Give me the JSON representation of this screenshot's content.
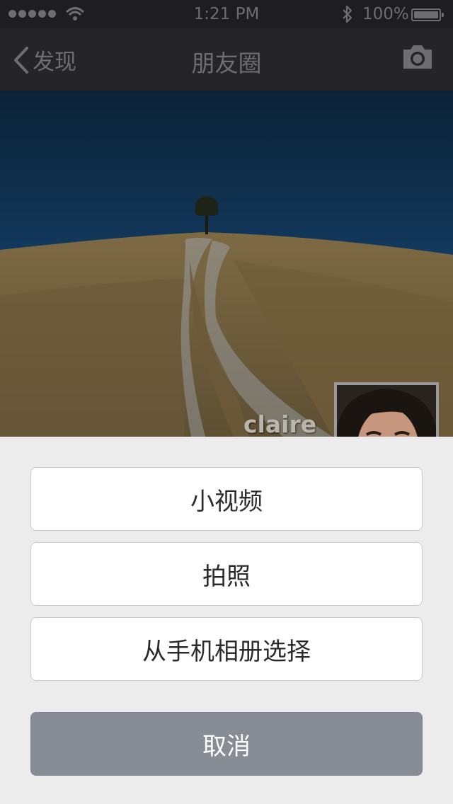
{
  "status_bar": {
    "time": "1:21 PM",
    "battery": "100%",
    "icons": [
      "signal-dots-icon",
      "wifi-icon",
      "bluetooth-icon",
      "battery-icon"
    ]
  },
  "nav": {
    "back_label": "发现",
    "title": "朋友圈",
    "icons": [
      "chevron-left-icon",
      "camera-icon"
    ]
  },
  "cover": {
    "username": "claire"
  },
  "action_sheet": {
    "options": [
      {
        "label": "小视频"
      },
      {
        "label": "拍照"
      },
      {
        "label": "从手机相册选择"
      }
    ],
    "cancel_label": "取消"
  }
}
